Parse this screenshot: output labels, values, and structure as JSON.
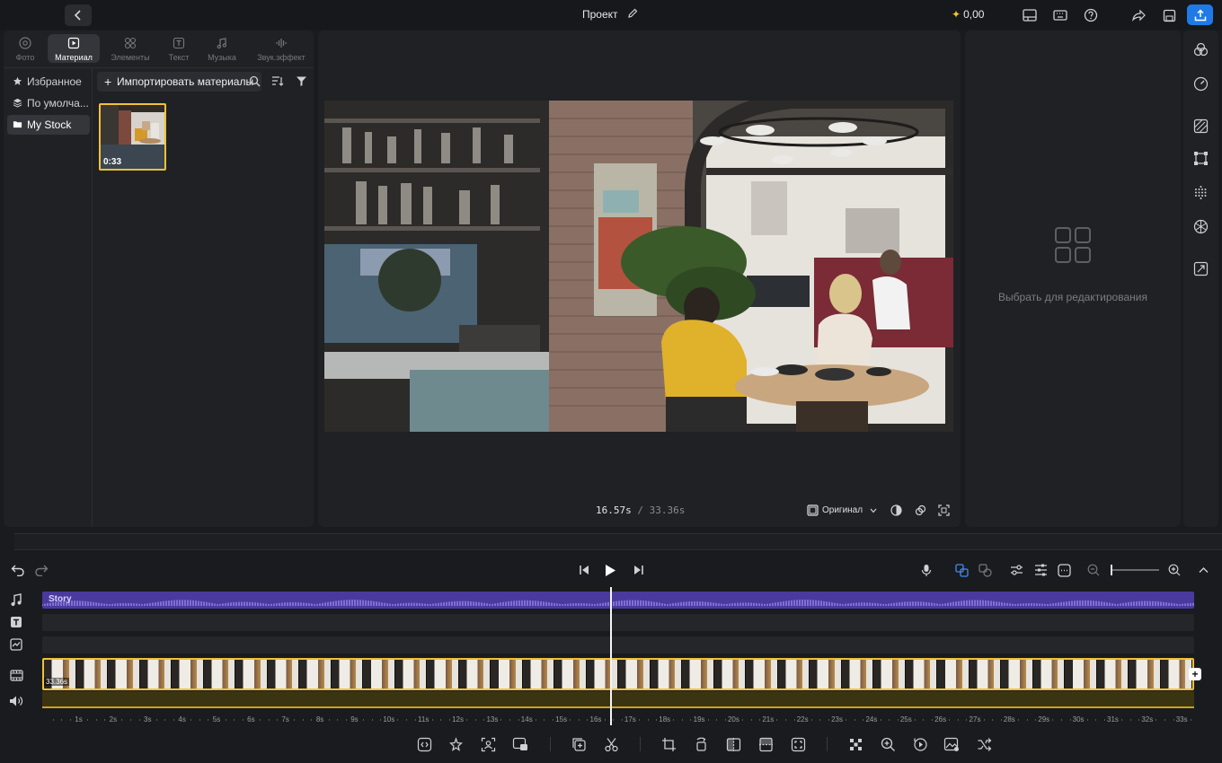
{
  "header": {
    "project_title": "Проект",
    "credits": "0,00"
  },
  "left_panel": {
    "tabs": [
      {
        "label": "Фото",
        "icon": "photo-icon"
      },
      {
        "label": "Материал",
        "icon": "media-icon",
        "active": true
      },
      {
        "label": "Элементы",
        "icon": "elements-icon"
      },
      {
        "label": "Текст",
        "icon": "text-icon"
      },
      {
        "label": "Музыка",
        "icon": "music-icon"
      },
      {
        "label": "Звук.эффект",
        "icon": "sound-effect-icon"
      }
    ],
    "nav": [
      {
        "label": "Избранное",
        "icon": "star-icon"
      },
      {
        "label": "По умолча...",
        "icon": "layers-icon"
      },
      {
        "label": "My Stock",
        "icon": "folder-icon",
        "active": true
      }
    ],
    "import_label": "Импортировать материалы",
    "media_item": {
      "duration": "0:33"
    }
  },
  "preview": {
    "current_time": "16.57s",
    "total_time": "/ 33.36s",
    "aspect_label": "Оригинал"
  },
  "properties": {
    "empty_text": "Выбрать для редактирования"
  },
  "timeline": {
    "audio_track_label": "Story",
    "clip_duration": "33.36s",
    "ruler_labels": [
      "1s",
      "2s",
      "3s",
      "4s",
      "5s",
      "6s",
      "7s",
      "8s",
      "9s",
      "10s",
      "11s",
      "12s",
      "13s",
      "14s",
      "15s",
      "16s",
      "17s",
      "18s",
      "19s",
      "20s",
      "21s",
      "22s",
      "23s",
      "24s",
      "25s",
      "26s",
      "27s",
      "28s",
      "29s",
      "30s",
      "31s",
      "32s",
      "33s"
    ],
    "playhead_seconds": 16.57,
    "duration_seconds": 33.36
  },
  "colors": {
    "accent": "#1f7ae8",
    "selection": "#f2c233",
    "audio_track": "#4a3a9e"
  }
}
